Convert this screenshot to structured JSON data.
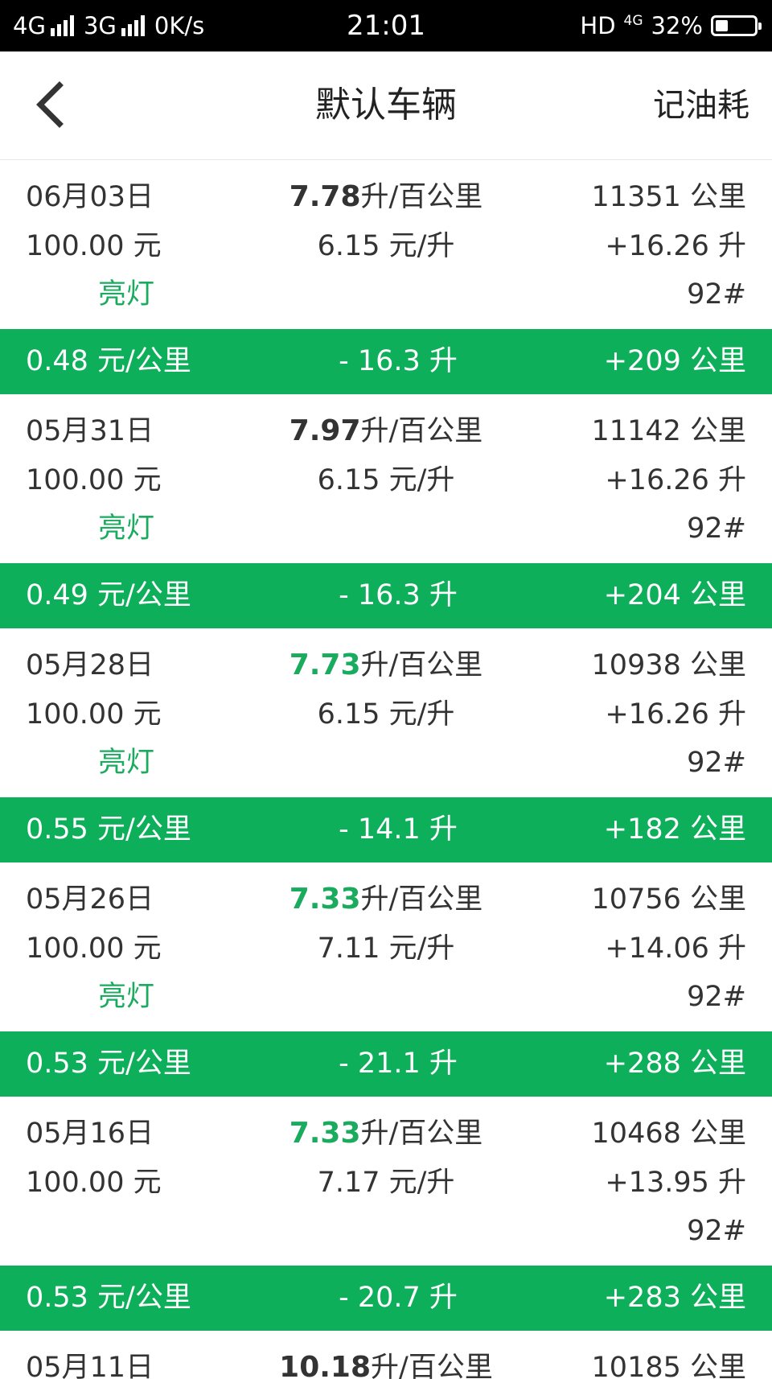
{
  "status_bar": {
    "signal1": "4G",
    "signal2": "3G",
    "speed": "0K/s",
    "time": "21:01",
    "hd": "HD",
    "net": "4G",
    "battery": "32%",
    "battery_level": 0.32
  },
  "header": {
    "back_icon": "chevron-left-icon",
    "title": "默认车辆",
    "action": "记油耗"
  },
  "records": [
    {
      "date": "06月03日",
      "amount": "100.00 元",
      "consumption": "7.78",
      "consumption_unit": "升/百公里",
      "consumption_highlight": false,
      "price": "6.15 元/升",
      "odometer": "11351 公里",
      "fuel_added": "+16.26 升",
      "fuel_grade": "92#",
      "light": "亮灯"
    },
    {
      "date": "05月31日",
      "amount": "100.00 元",
      "consumption": "7.97",
      "consumption_unit": "升/百公里",
      "consumption_highlight": false,
      "price": "6.15 元/升",
      "odometer": "11142 公里",
      "fuel_added": "+16.26 升",
      "fuel_grade": "92#",
      "light": "亮灯"
    },
    {
      "date": "05月28日",
      "amount": "100.00 元",
      "consumption": "7.73",
      "consumption_unit": "升/百公里",
      "consumption_highlight": true,
      "price": "6.15 元/升",
      "odometer": "10938 公里",
      "fuel_added": "+16.26 升",
      "fuel_grade": "92#",
      "light": "亮灯"
    },
    {
      "date": "05月26日",
      "amount": "100.00 元",
      "consumption": "7.33",
      "consumption_unit": "升/百公里",
      "consumption_highlight": true,
      "price": "7.11 元/升",
      "odometer": "10756 公里",
      "fuel_added": "+14.06 升",
      "fuel_grade": "92#",
      "light": "亮灯"
    },
    {
      "date": "05月16日",
      "amount": "100.00 元",
      "consumption": "7.33",
      "consumption_unit": "升/百公里",
      "consumption_highlight": true,
      "price": "7.17 元/升",
      "odometer": "10468 公里",
      "fuel_added": "+13.95 升",
      "fuel_grade": "92#",
      "light": ""
    }
  ],
  "summaries": [
    {
      "cost_per_km": "0.48 元/公里",
      "fuel_used": "- 16.3 升",
      "distance": "+209 公里"
    },
    {
      "cost_per_km": "0.49 元/公里",
      "fuel_used": "- 16.3 升",
      "distance": "+204 公里"
    },
    {
      "cost_per_km": "0.55 元/公里",
      "fuel_used": "- 14.1 升",
      "distance": "+182 公里"
    },
    {
      "cost_per_km": "0.53 元/公里",
      "fuel_used": "- 21.1 升",
      "distance": "+288 公里"
    },
    {
      "cost_per_km": "0.53 元/公里",
      "fuel_used": "- 20.7 升",
      "distance": "+283 公里"
    }
  ],
  "partial_record": {
    "date": "05月11日",
    "consumption": "10.18",
    "consumption_unit": "升/百公里",
    "odometer": "10185 公里"
  },
  "colors": {
    "accent": "#0daf5a",
    "accent_text": "#1aab5f",
    "text": "#333333"
  }
}
